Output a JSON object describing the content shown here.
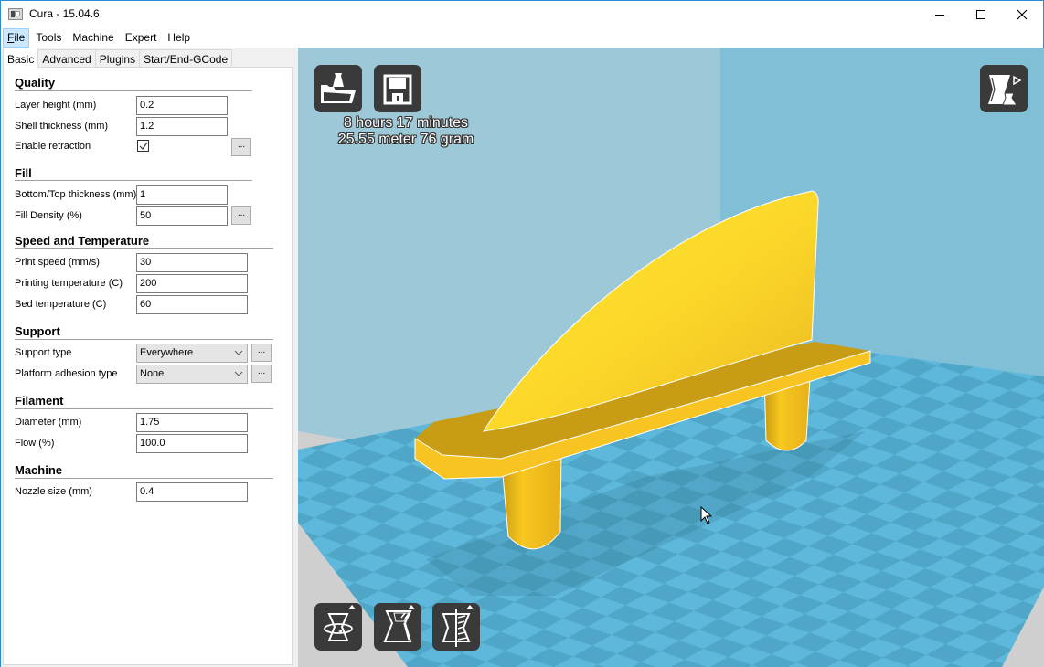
{
  "window": {
    "title": "Cura - 15.04.6",
    "controls": {
      "minimize": "minimize",
      "maximize": "maximize",
      "close": "close"
    }
  },
  "menu": [
    {
      "label": "File",
      "mnemonic": "F",
      "rest": "ile",
      "active": true
    },
    {
      "label": "Tools"
    },
    {
      "label": "Machine"
    },
    {
      "label": "Expert"
    },
    {
      "label": "Help"
    }
  ],
  "tabs": [
    {
      "label": "Basic",
      "active": true
    },
    {
      "label": "Advanced"
    },
    {
      "label": "Plugins"
    },
    {
      "label": "Start/End-GCode"
    }
  ],
  "settings": {
    "quality": {
      "title": "Quality",
      "layer_height": {
        "label": "Layer height (mm)",
        "value": "0.2"
      },
      "shell_thickness": {
        "label": "Shell thickness (mm)",
        "value": "1.2"
      },
      "enable_retraction": {
        "label": "Enable retraction",
        "checked": true,
        "more": "..."
      }
    },
    "fill": {
      "title": "Fill",
      "bottom_top": {
        "label": "Bottom/Top thickness (mm)",
        "value": "1"
      },
      "fill_density": {
        "label": "Fill Density (%)",
        "value": "50",
        "more": "..."
      }
    },
    "speed": {
      "title": "Speed and Temperature",
      "print_speed": {
        "label": "Print speed (mm/s)",
        "value": "30"
      },
      "print_temp": {
        "label": "Printing temperature (C)",
        "value": "200"
      },
      "bed_temp": {
        "label": "Bed temperature (C)",
        "value": "60"
      }
    },
    "support": {
      "title": "Support",
      "support_type": {
        "label": "Support type",
        "value": "Everywhere",
        "more": "..."
      },
      "adhesion": {
        "label": "Platform adhesion type",
        "value": "None",
        "more": "..."
      }
    },
    "filament": {
      "title": "Filament",
      "diameter": {
        "label": "Diameter (mm)",
        "value": "1.75"
      },
      "flow": {
        "label": "Flow (%)",
        "value": "100.0"
      }
    },
    "machine": {
      "title": "Machine",
      "nozzle": {
        "label": "Nozzle size (mm)",
        "value": "0.4"
      }
    }
  },
  "viewport": {
    "print_time": "8 hours 17 minutes",
    "print_material": "25.55 meter 76 gram",
    "buttons": {
      "load": "load-model",
      "save": "save-toolpath",
      "view_mode": "view-mode",
      "rotate": "rotate",
      "scale": "scale",
      "mirror": "mirror"
    },
    "colors": {
      "model": "#f7c61c",
      "bed_light": "#5db8dc",
      "bed_dark": "#4fa6c6",
      "background": "#80bfd6",
      "button": "#3a3a3a"
    }
  }
}
